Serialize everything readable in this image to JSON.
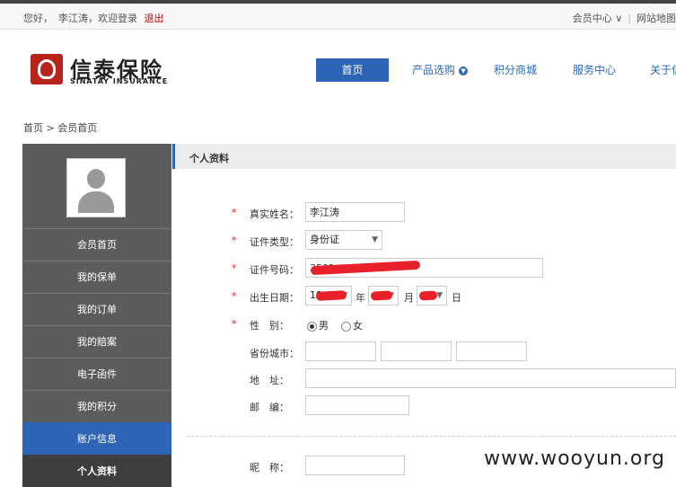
{
  "topbar": {
    "greeting": "您好，",
    "username": "李江涛",
    "welcome": "，欢迎登录",
    "logout": "退出",
    "member_center": "会员中心",
    "sitemap": "网站地图"
  },
  "logo": {
    "cn": "信泰保险",
    "en": "SINATAY INSURANCE"
  },
  "nav": {
    "items": [
      "首页",
      "产品选购",
      "积分商城",
      "服务中心",
      "关于信"
    ]
  },
  "breadcrumb": "首页 > 会员首页",
  "sidebar": {
    "menu": [
      "会员首页",
      "我的保单",
      "我的订单",
      "我的赔案",
      "电子函件",
      "我的积分",
      "账户信息",
      "个人资料"
    ]
  },
  "panel": {
    "title": "个人资料"
  },
  "form": {
    "real_name_label": "真实姓名：",
    "real_name_value": "李江涛",
    "id_type_label": "证件类型：",
    "id_type_value": "身份证",
    "id_no_label": "证件号码：",
    "id_no_value": "3501",
    "birth_label": "出生日期：",
    "birth_year": "19",
    "year_unit": "年",
    "month_unit": "月",
    "day_unit": "日",
    "gender_label": "性　别：",
    "gender_male": "男",
    "gender_female": "女",
    "province_label": "省份城市：",
    "address_label": "地　址：",
    "zip_label": "邮　编：",
    "nickname_label": "昵　称："
  },
  "watermark": "www.wooyun.org",
  "colors": {
    "accent": "#2e64b5",
    "required": "#dd2222",
    "sidebar": "#5c5c5c"
  }
}
